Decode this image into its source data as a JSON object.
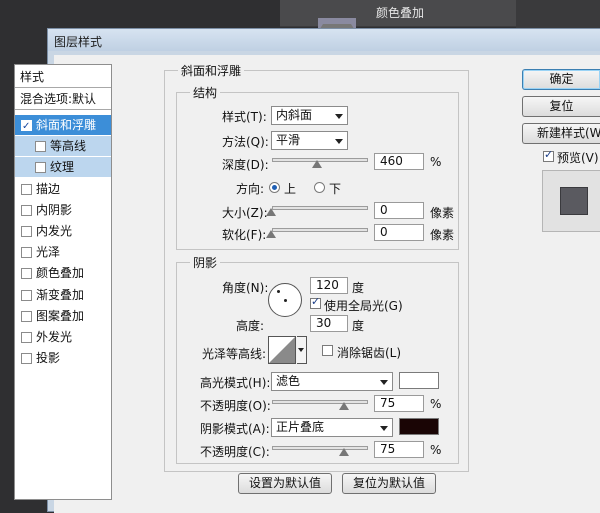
{
  "background": {
    "layer_strip_label": "颜色叠加"
  },
  "dialog": {
    "title": "图层样式"
  },
  "style_list": {
    "header": "样式",
    "blend_options": "混合选项:默认",
    "items": [
      {
        "label": "斜面和浮雕",
        "checked": true,
        "selected": true
      },
      {
        "label": "等高线",
        "checked": false,
        "sub": true
      },
      {
        "label": "纹理",
        "checked": false,
        "sub": true
      },
      {
        "label": "描边",
        "checked": false
      },
      {
        "label": "内阴影",
        "checked": false
      },
      {
        "label": "内发光",
        "checked": false
      },
      {
        "label": "光泽",
        "checked": false
      },
      {
        "label": "颜色叠加",
        "checked": false
      },
      {
        "label": "渐变叠加",
        "checked": false
      },
      {
        "label": "图案叠加",
        "checked": false
      },
      {
        "label": "外发光",
        "checked": false
      },
      {
        "label": "投影",
        "checked": false
      }
    ]
  },
  "bevel": {
    "title": "斜面和浮雕",
    "structure": {
      "title": "结构",
      "style_label": "样式(T):",
      "style_value": "内斜面",
      "technique_label": "方法(Q):",
      "technique_value": "平滑",
      "depth_label": "深度(D):",
      "depth_value": "460",
      "depth_unit": "%",
      "depth_percent": 460,
      "direction_label": "方向:",
      "direction_up": "上",
      "direction_down": "下",
      "direction_selected": "上",
      "size_label": "大小(Z):",
      "size_value": "0",
      "size_unit": "像素",
      "soften_label": "软化(F):",
      "soften_value": "0",
      "soften_unit": "像素"
    },
    "shading": {
      "title": "阴影",
      "angle_label": "角度(N):",
      "angle_value": "120",
      "angle_unit": "度",
      "global_light_label": "使用全局光(G)",
      "global_light_checked": true,
      "altitude_label": "高度:",
      "altitude_value": "30",
      "altitude_unit": "度",
      "gloss_contour_label": "光泽等高线:",
      "anti_alias_label": "消除锯齿(L)",
      "anti_alias_checked": false,
      "highlight_mode_label": "高光模式(H):",
      "highlight_mode_value": "滤色",
      "highlight_color": "#ffffff",
      "highlight_opacity_label": "不透明度(O):",
      "highlight_opacity_value": "75",
      "highlight_opacity_unit": "%",
      "shadow_mode_label": "阴影模式(A):",
      "shadow_mode_value": "正片叠底",
      "shadow_color": "#1a0505",
      "shadow_opacity_label": "不透明度(C):",
      "shadow_opacity_value": "75",
      "shadow_opacity_unit": "%"
    },
    "make_default_label": "设置为默认值",
    "reset_default_label": "复位为默认值"
  },
  "actions": {
    "ok_label": "确定",
    "reset_label": "复位",
    "new_style_label": "新建样式(W)",
    "preview_label": "预览(V)",
    "preview_checked": true
  },
  "colors": {
    "accent": "#3c8ed8",
    "preview_swatch": "#5a5a60"
  }
}
